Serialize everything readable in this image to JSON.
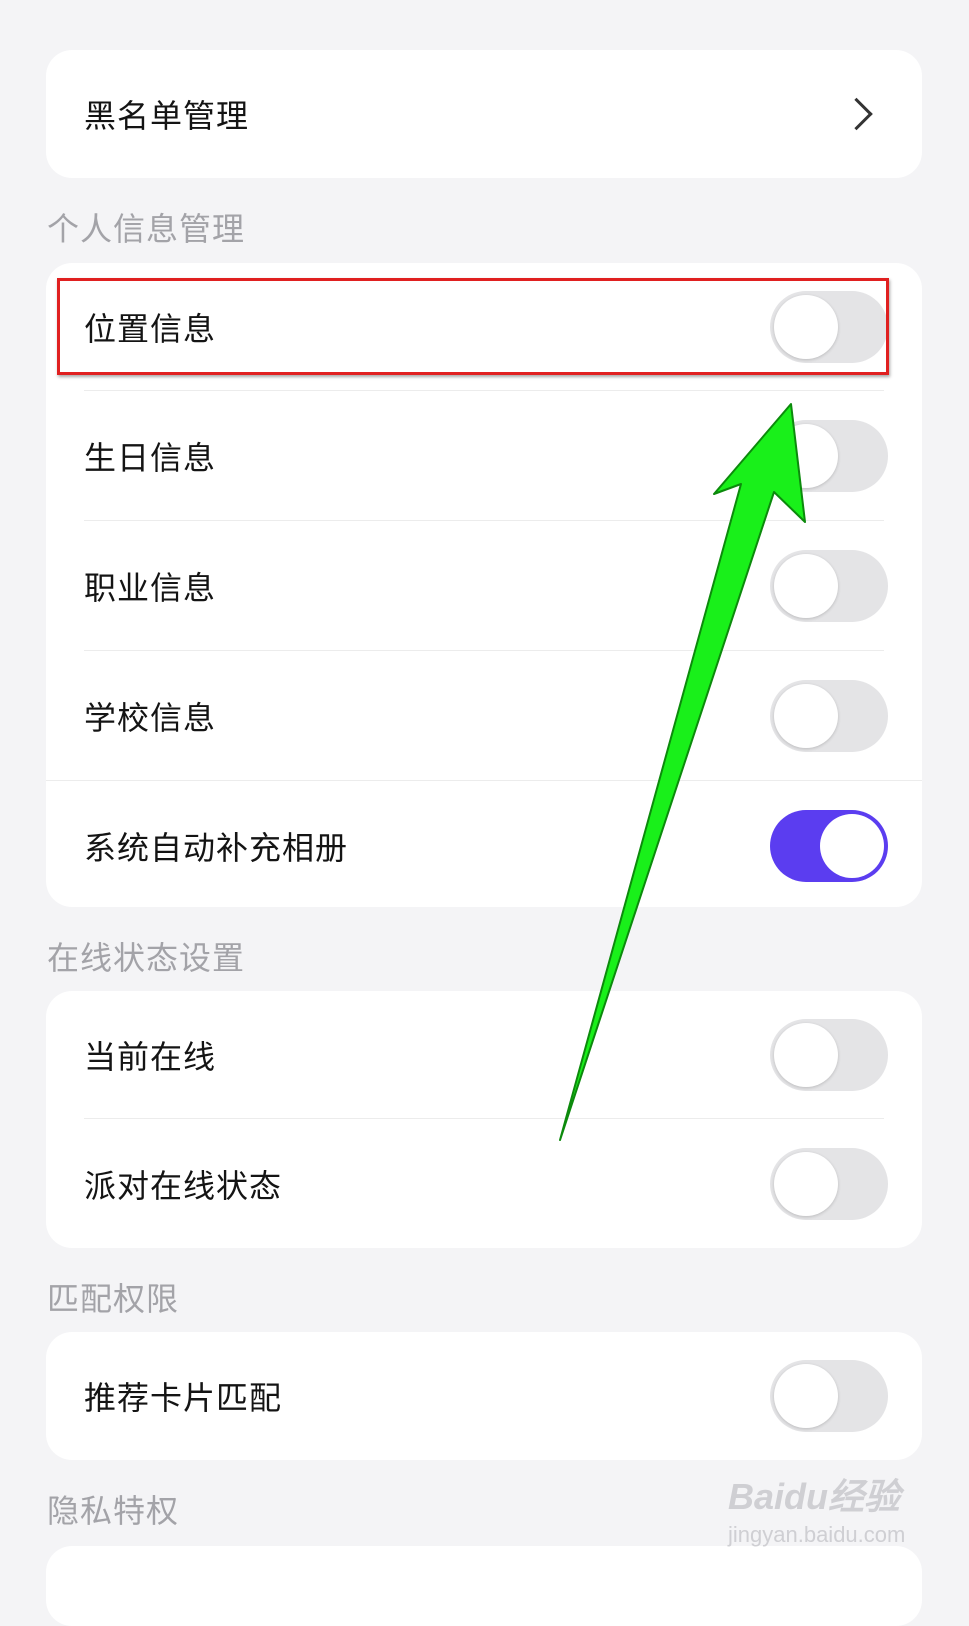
{
  "blacklist": {
    "label": "黑名单管理",
    "icon": "chevron-right-icon"
  },
  "sections": {
    "personal_info": {
      "title": "个人信息管理",
      "items": [
        {
          "label": "位置信息",
          "enabled": false
        },
        {
          "label": "生日信息",
          "enabled": false
        },
        {
          "label": "职业信息",
          "enabled": false
        },
        {
          "label": "学校信息",
          "enabled": false
        },
        {
          "label": "系统自动补充相册",
          "enabled": true
        }
      ]
    },
    "online_status": {
      "title": "在线状态设置",
      "items": [
        {
          "label": "当前在线",
          "enabled": false
        },
        {
          "label": "派对在线状态",
          "enabled": false
        }
      ]
    },
    "match": {
      "title": "匹配权限",
      "items": [
        {
          "label": "推荐卡片匹配",
          "enabled": false
        }
      ]
    },
    "privacy": {
      "title": "隐私特权"
    }
  },
  "colors": {
    "toggle_on": "#5b3df0",
    "toggle_off": "#e4e4e6",
    "highlight_border": "#e02020",
    "annotation_arrow": "#19f01a"
  },
  "watermark": {
    "main": "Baidu经验",
    "sub": "jingyan.baidu.com"
  }
}
